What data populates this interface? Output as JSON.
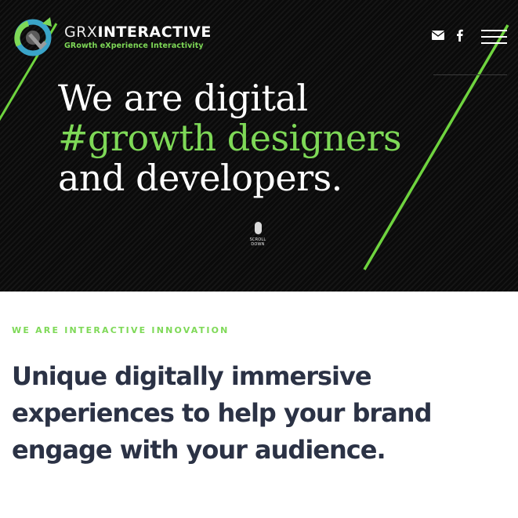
{
  "header": {
    "logo_title_light": "GRX",
    "logo_title_bold": "INTERACTIVE",
    "logo_tagline": "GRowth eXperience Interactivity",
    "icons": [
      "envelope-icon",
      "facebook-icon",
      "menu-icon"
    ]
  },
  "hero": {
    "headline_line1": "We are digital",
    "headline_line2": "#growth designers",
    "headline_line3": "and developers.",
    "scroll_label": "SCROLL DOWN"
  },
  "intro": {
    "eyebrow": "WE ARE INTERACTIVE INNOVATION",
    "line1": "Unique digitally immersive",
    "line2": "experiences to help your brand",
    "line3": "engage with your audience."
  },
  "colors": {
    "accent_green": "#7ed957",
    "hero_background": "#0c0c0c",
    "heading_navy": "#2b3245"
  }
}
